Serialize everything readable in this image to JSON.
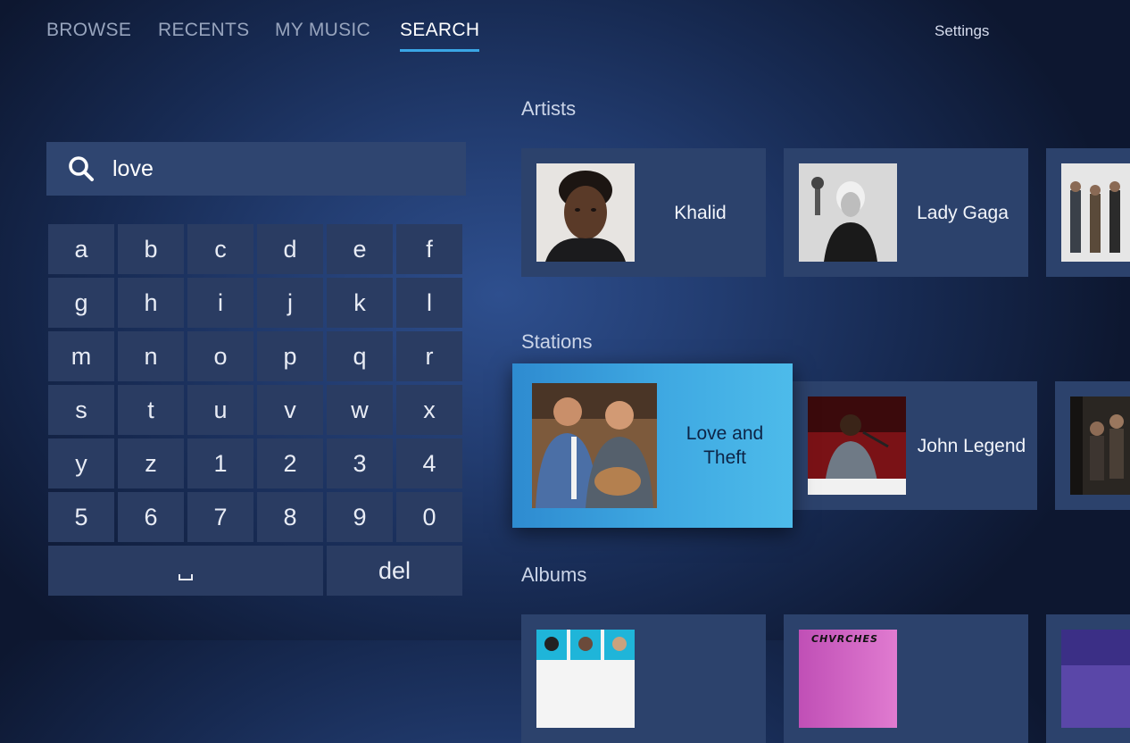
{
  "nav": {
    "tabs": [
      "BROWSE",
      "RECENTS",
      "MY MUSIC",
      "SEARCH"
    ],
    "active_tab": "SEARCH",
    "settings": "Settings"
  },
  "search": {
    "query": "love",
    "icon": "search-icon"
  },
  "keyboard": {
    "rows": [
      [
        "a",
        "b",
        "c",
        "d",
        "e",
        "f"
      ],
      [
        "g",
        "h",
        "i",
        "j",
        "k",
        "l"
      ],
      [
        "m",
        "n",
        "o",
        "p",
        "q",
        "r"
      ],
      [
        "s",
        "t",
        "u",
        "v",
        "w",
        "x"
      ],
      [
        "y",
        "z",
        "1",
        "2",
        "3",
        "4"
      ],
      [
        "5",
        "6",
        "7",
        "8",
        "9",
        "0"
      ]
    ],
    "space_label": "␣",
    "delete_label": "del"
  },
  "sections": {
    "artists": {
      "title": "Artists",
      "items": [
        {
          "name": "Khalid"
        },
        {
          "name": "Lady Gaga"
        },
        {
          "name": ""
        }
      ]
    },
    "stations": {
      "title": "Stations",
      "items": [
        {
          "name": "Love and Theft",
          "focused": true
        },
        {
          "name": "John Legend"
        },
        {
          "name": ""
        }
      ]
    },
    "albums": {
      "title": "Albums",
      "items": [
        {
          "name": "",
          "art_text": ""
        },
        {
          "name": "",
          "art_text": "CHVRCHES"
        },
        {
          "name": ""
        }
      ]
    }
  },
  "colors": {
    "accent": "#3aa6e6",
    "card_bg": "#2c426c",
    "key_bg": "#2a3c62",
    "focused_card": "#3fa9e2"
  }
}
